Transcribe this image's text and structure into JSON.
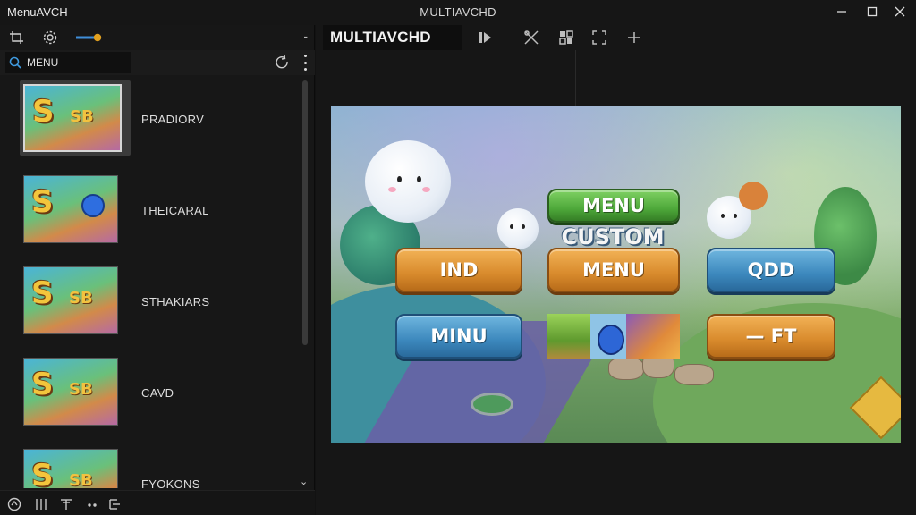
{
  "window": {
    "app_name": "MenuAVCH",
    "title": "MULTIAVCHD"
  },
  "left_panel": {
    "search": {
      "value": "MENU",
      "placeholder": ""
    },
    "items": [
      {
        "label": "PRADIORV",
        "selected": true
      },
      {
        "label": "THEICARAL",
        "selected": false
      },
      {
        "label": "STHAKIARS",
        "selected": false
      },
      {
        "label": "CAVD",
        "selected": false
      },
      {
        "label": "FYOKONS",
        "selected": false
      }
    ],
    "thumb_logo": "S",
    "thumb_logo_small": "SB"
  },
  "right_panel": {
    "tab_label": "MULTIAVCHD",
    "preview": {
      "top_button": "MENU",
      "center_title": "CUSTOM",
      "buttons": {
        "left_top": "IND",
        "center": "MENU",
        "right_top": "QDD",
        "left_bottom": "MINU",
        "right_bottom": "— FT"
      }
    }
  },
  "colors": {
    "orange_button": "#d88a2c",
    "blue_button": "#3c88bd",
    "green_button": "#4ea83a",
    "background": "#121212"
  },
  "icons": [
    "crop-icon",
    "gear-icon",
    "toggle-icon",
    "search-icon",
    "refresh-icon",
    "more-icon",
    "play-icon",
    "tools-icon",
    "grid-icon",
    "expand-icon",
    "add-icon",
    "home-icon",
    "columns-icon",
    "pin-icon",
    "dots-icon",
    "list-icon"
  ]
}
